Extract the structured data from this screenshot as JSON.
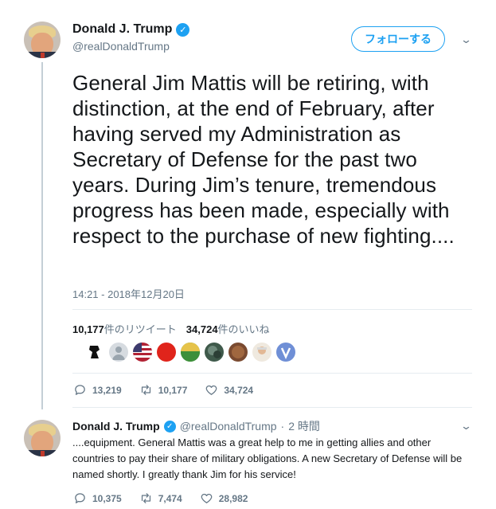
{
  "tweet": {
    "display_name": "Donald J. Trump",
    "handle": "@realDonaldTrump",
    "follow_label": "フォローする",
    "text": "General Jim Mattis will be retiring, with distinction, at the end of February, after having served my Administration as Secretary of Defense for the past two years. During Jim’s tenure, tremendous progress has been made, especially with respect to the purchase of new fighting....",
    "timestamp": "14:21 - 2018年12月20日",
    "retweets_count": "10,177",
    "retweets_label": "件のリツイート",
    "likes_count": "34,724",
    "likes_label": "件のいいね",
    "likers": [
      {
        "name": "liker-1",
        "color": "#d9d9d9"
      },
      {
        "name": "liker-2",
        "color": "#cfd4d8"
      },
      {
        "name": "liker-3",
        "color": "#3a4f8f"
      },
      {
        "name": "liker-4",
        "color": "#e0241b"
      },
      {
        "name": "liker-5",
        "color": "#3d8f3a"
      },
      {
        "name": "liker-6",
        "color": "#4f6b5a"
      },
      {
        "name": "liker-7",
        "color": "#8a5a3c"
      },
      {
        "name": "liker-8",
        "color": "#e8e2d6"
      },
      {
        "name": "liker-9",
        "color": "#6f8fd6"
      }
    ],
    "actions": {
      "replies": "13,219",
      "retweets": "10,177",
      "likes": "34,724"
    }
  },
  "reply": {
    "display_name": "Donald J. Trump",
    "handle": "@realDonaldTrump",
    "separator": "·",
    "time_ago": "2 時間",
    "text": "....equipment. General Mattis was a great help to me in getting allies and other countries to pay their share of military obligations. A new Secretary of Defense will be named shortly. I greatly thank Jim for his service!",
    "actions": {
      "replies": "10,375",
      "retweets": "7,474",
      "likes": "28,982"
    }
  },
  "colors": {
    "accent": "#1da1f2",
    "muted": "#657786",
    "text": "#14171a",
    "divider": "#e6ecf0"
  },
  "icons": [
    "verified-badge-icon",
    "chevron-down-icon",
    "reply-icon",
    "retweet-icon",
    "like-icon"
  ]
}
